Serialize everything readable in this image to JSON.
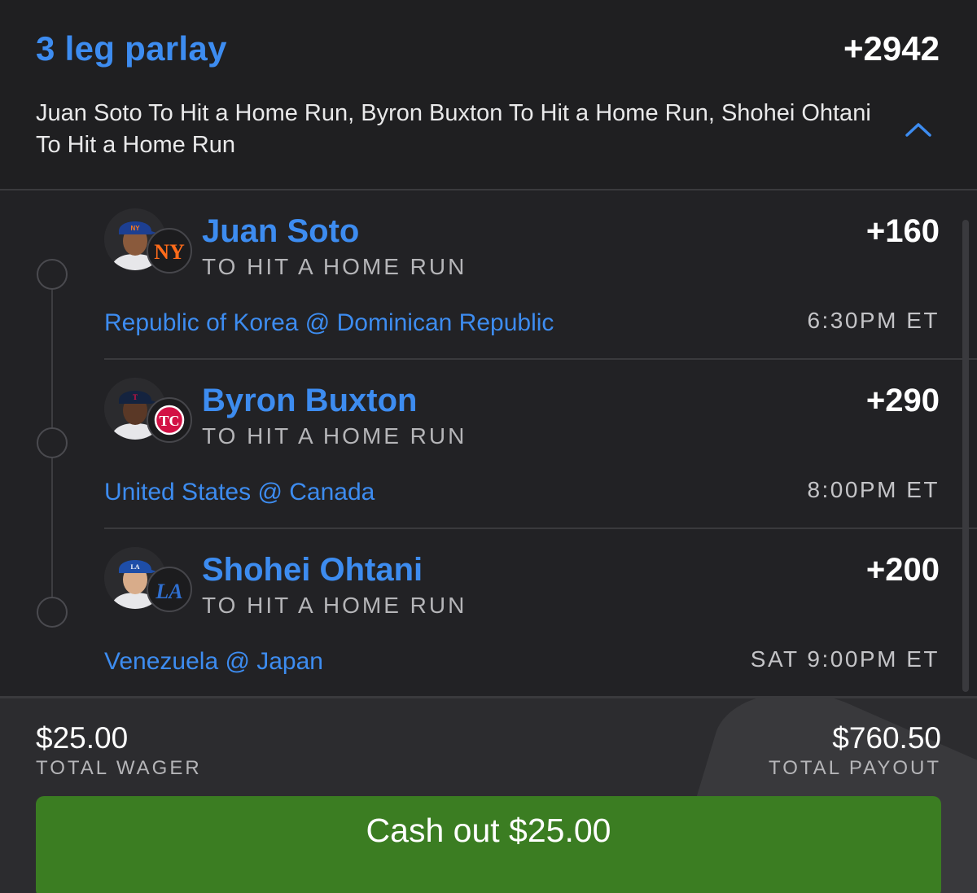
{
  "parlay": {
    "title": "3 leg parlay",
    "odds": "+2942",
    "description": "Juan Soto To Hit a Home Run, Byron Buxton To Hit a Home Run, Shohei Ohtani To Hit a Home Run",
    "collapse_icon": "chevron-up-icon"
  },
  "legs": [
    {
      "player": "Juan Soto",
      "market": "TO HIT A HOME RUN",
      "odds": "+160",
      "matchup": "Republic of Korea @ Dominican Republic",
      "time": "6:30PM ET",
      "team_icon": "mets-logo-icon"
    },
    {
      "player": "Byron Buxton",
      "market": "TO HIT A HOME RUN",
      "odds": "+290",
      "matchup": "United States @ Canada",
      "time": "8:00PM ET",
      "team_icon": "twins-logo-icon"
    },
    {
      "player": "Shohei Ohtani",
      "market": "TO HIT A HOME RUN",
      "odds": "+200",
      "matchup": "Venezuela @ Japan",
      "time": "SAT 9:00PM ET",
      "team_icon": "dodgers-logo-icon"
    }
  ],
  "footer": {
    "wager_amount": "$25.00",
    "wager_label": "TOTAL WAGER",
    "payout_amount": "$760.50",
    "payout_label": "TOTAL PAYOUT",
    "cashout_label": "Cash out $25.00"
  },
  "colors": {
    "accent_blue": "#3d8cf0",
    "cashout_green": "#3b7d22",
    "background": "#1f1f21"
  }
}
